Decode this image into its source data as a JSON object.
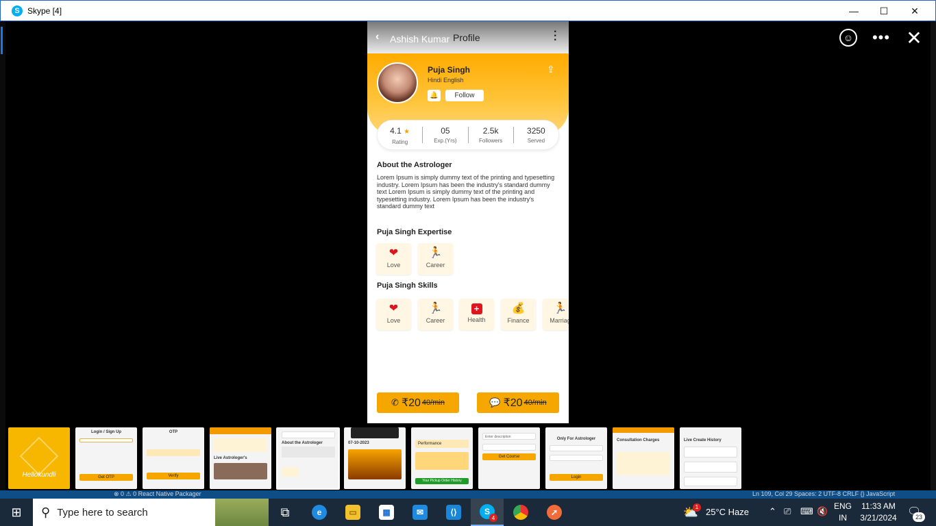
{
  "window": {
    "app_icon": "S",
    "title": "Skype [4]",
    "minimize": "—",
    "maximize": "☐",
    "close": "✕"
  },
  "viewer": {
    "emoji_icon": "☺",
    "more_icon": "•••",
    "close_icon": "✕"
  },
  "phone": {
    "header": {
      "back": "‹",
      "name": "Ashish Kumar",
      "title": "Profile"
    },
    "profile": {
      "name": "Puja Singh",
      "languages": "Hindi English",
      "follow_label": "Follow"
    },
    "stats": [
      {
        "value": "4.1",
        "label": "Rating",
        "star": "★"
      },
      {
        "value": "05",
        "label": "Exp.(Yrs)"
      },
      {
        "value": "2.5k",
        "label": "Followers"
      },
      {
        "value": "3250",
        "label": "Served"
      }
    ],
    "about_title": "About the Astrologer",
    "about_text": "Lorem Ipsum is simply dummy text of the printing and typesetting industry. Lorem Ipsum has been the industry's standard dummy text Lorem Ipsum is simply dummy text of the printing and typesetting industry. Lorem Ipsum has been the industry's standard dummy text",
    "expertise_title": "Puja Singh Expertise",
    "expertise": [
      {
        "label": "Love",
        "icon": "heart-icon",
        "glyph": "❤"
      },
      {
        "label": "Career",
        "icon": "career-icon",
        "glyph": "🏃"
      }
    ],
    "skills_title": "Puja Singh Skills",
    "skills": [
      {
        "label": "Love",
        "icon": "heart-icon",
        "glyph": "❤"
      },
      {
        "label": "Career",
        "icon": "career-icon",
        "glyph": "🏃"
      },
      {
        "label": "Health",
        "icon": "health-icon",
        "glyph": "+"
      },
      {
        "label": "Finance",
        "icon": "money-bag-icon",
        "glyph": "💰"
      },
      {
        "label": "Marriag",
        "icon": "marriage-icon",
        "glyph": "🏃"
      }
    ],
    "call": {
      "price": "₹20",
      "per": "40/min"
    },
    "chat": {
      "price": "₹20",
      "per": "40/min"
    }
  },
  "thumbnails": [
    {
      "label": "Hellokundli",
      "kind": "logo"
    },
    {
      "label": "Login / Sign Up",
      "button": "Get OTP"
    },
    {
      "label": "OTP",
      "button": "Verify"
    },
    {
      "label": "Live Astrologer's",
      "button": ""
    },
    {
      "label": "About the Astrologer",
      "button": ""
    },
    {
      "label": "07-10-2023",
      "button": ""
    },
    {
      "label": "Performance",
      "button": "Your Pickup Order History"
    },
    {
      "label": "Enter description",
      "button": "Get Course"
    },
    {
      "label": "Only For Astrologer",
      "button": "Login"
    },
    {
      "label": "Consultation Charges",
      "button": ""
    },
    {
      "label": "Live Create History",
      "button": ""
    }
  ],
  "background_strip": {
    "left": "⊗ 0 ⚠ 0     React Native Packager",
    "right": "Ln 109, Col 29    Spaces: 2    UTF-8    CRLF    {} JavaScript"
  },
  "taskbar": {
    "search_placeholder": "Type here to search",
    "skype_badge": "4",
    "weather": "25°C  Haze",
    "weather_badge": "1",
    "lang_top": "ENG",
    "lang_bottom": "IN",
    "time": "11:33 AM",
    "date": "3/21/2024",
    "notif_count": "23"
  },
  "colors": {
    "accent_orange": "#f5a700",
    "skype_blue": "#00aff0",
    "taskbar": "#1b2a3a"
  }
}
